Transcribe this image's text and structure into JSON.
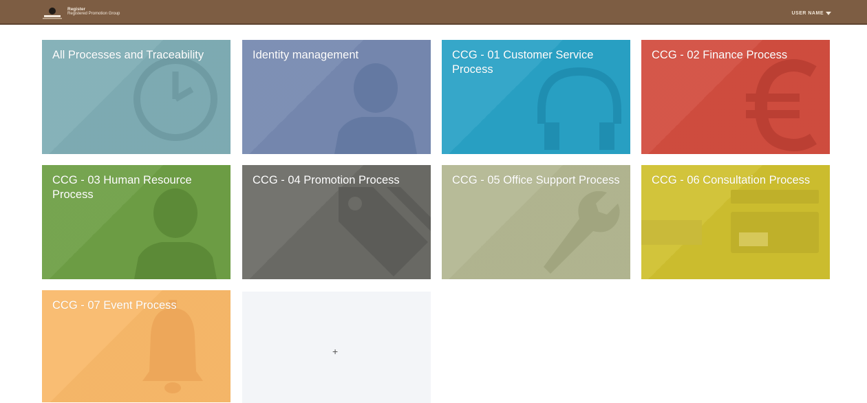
{
  "header": {
    "logo_line1": "Register",
    "logo_line2": "Registered Promotion Group",
    "user_name": "USER NAME"
  },
  "tiles": [
    {
      "label": "All Processes and Traceability",
      "color": "#7fadb5",
      "icon": "clock-icon"
    },
    {
      "label": "Identity management",
      "color": "#7689b0",
      "icon": "person-icon"
    },
    {
      "label": "CCG - 01 Customer Service Process",
      "color": "#29a2c6",
      "icon": "headphones-icon"
    },
    {
      "label": "CCG - 02 Finance Process",
      "color": "#d24d3f",
      "icon": "euro-icon"
    },
    {
      "label": "CCG - 03 Human Resource Process",
      "color": "#6e9f45",
      "icon": "person-icon"
    },
    {
      "label": "CCG - 04 Promotion Process",
      "color": "#6b6b66",
      "icon": "tag-icon"
    },
    {
      "label": "CCG - 05 Office Support Process",
      "color": "#b3b792",
      "icon": "wrench-icon"
    },
    {
      "label": "CCG - 06 Consultation Process",
      "color": "#cfc02f",
      "icon": "card-icon"
    },
    {
      "label": "CCG - 07 Event Process",
      "color": "#f9b96a",
      "icon": "bell-icon"
    }
  ],
  "add_tile": {
    "label": "+"
  }
}
